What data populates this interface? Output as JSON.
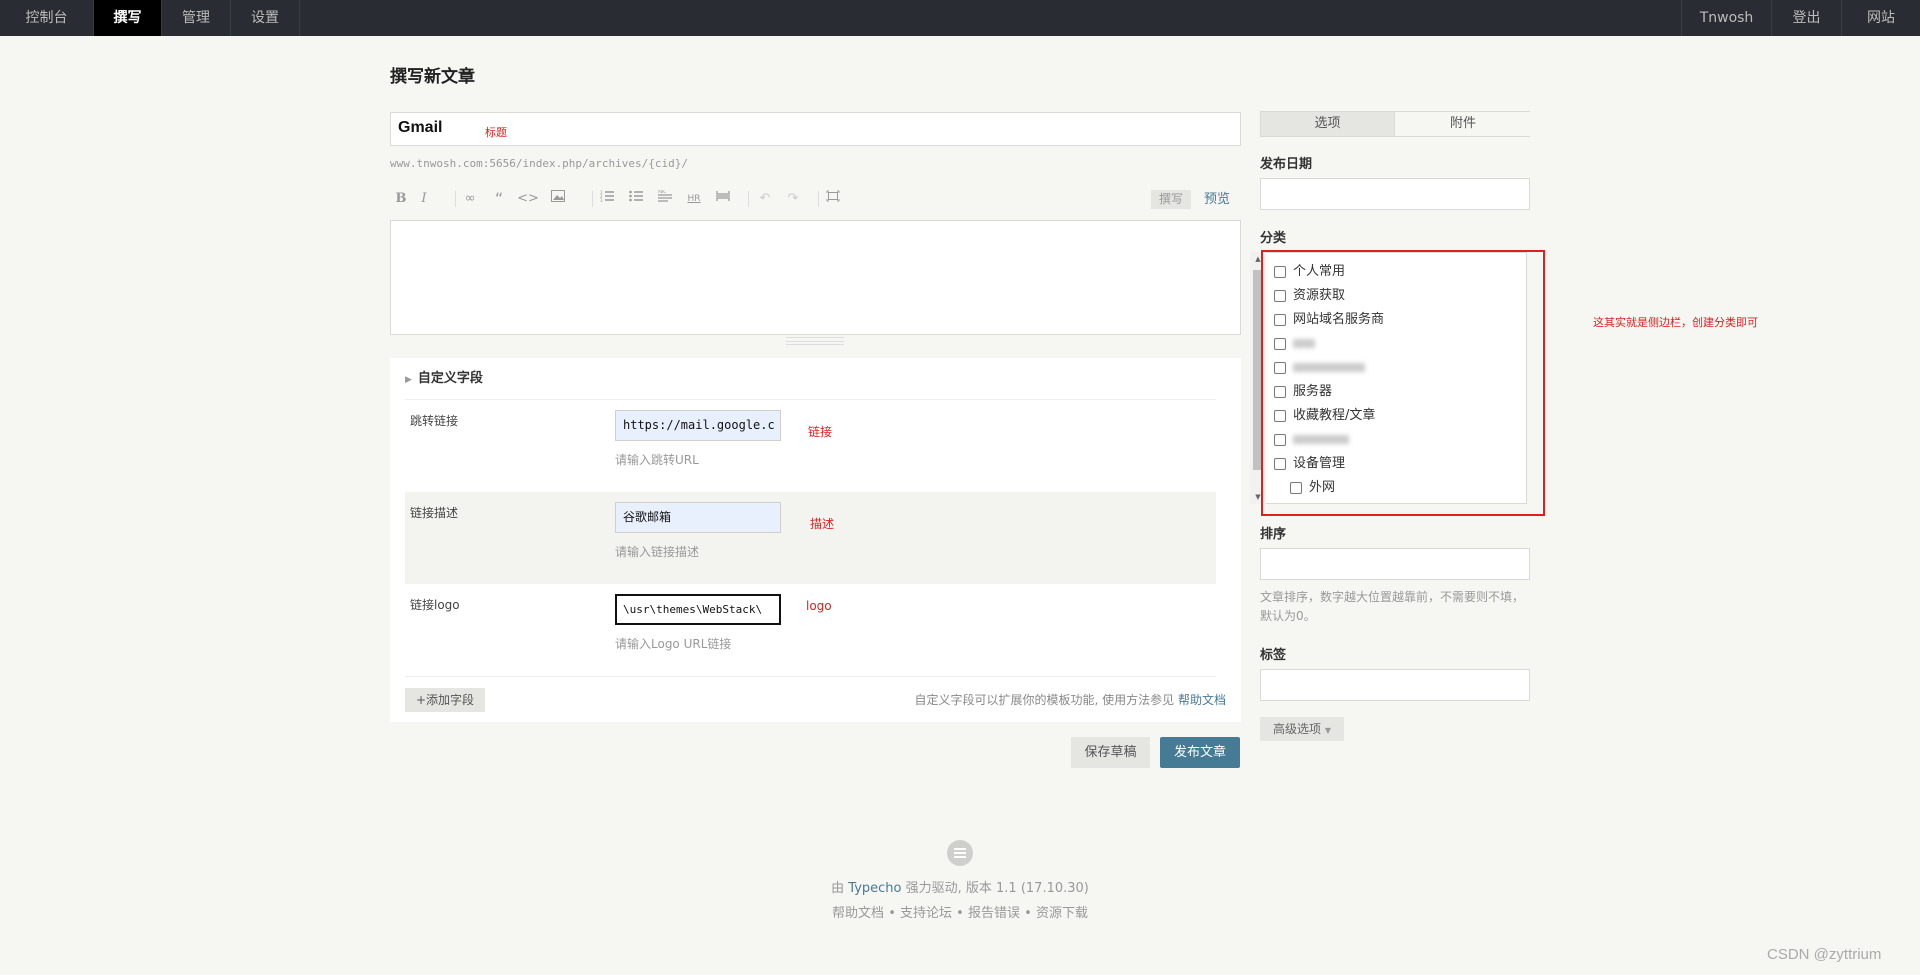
{
  "nav": {
    "left": [
      "控制台",
      "撰写",
      "管理",
      "设置"
    ],
    "right": [
      "Tnwosh",
      "登出",
      "网站"
    ]
  },
  "page_title": "撰写新文章",
  "title_field": {
    "value": "Gmail",
    "annotation": "标题"
  },
  "permalink": "www.tnwosh.com:5656/index.php/archives/{cid}/",
  "editor": {
    "tab_write": "撰写",
    "tab_preview": "预览",
    "icons": [
      "bold-icon",
      "italic-icon",
      "link-icon",
      "quote-icon",
      "code-icon",
      "image-icon",
      "ordered-list-icon",
      "unordered-list-icon",
      "heading-icon",
      "hr-icon",
      "more-icon",
      "undo-icon",
      "redo-icon",
      "fullscreen-icon"
    ]
  },
  "custom_fields": {
    "header": "自定义字段",
    "rows": [
      {
        "label": "跳转链接",
        "value": "https://mail.google.c",
        "hint": "请输入跳转URL",
        "annotation": "链接"
      },
      {
        "label": "链接描述",
        "value": "谷歌邮箱",
        "hint": "请输入链接描述",
        "annotation": "描述"
      },
      {
        "label": "链接logo",
        "value": "\\usr\\themes\\WebStack\\",
        "hint": "请输入Logo URL链接",
        "annotation": "logo"
      }
    ],
    "add_button": "+添加字段",
    "note": "自定义字段可以扩展你的模板功能, 使用方法参见",
    "note_link": "帮助文档"
  },
  "actions": {
    "save_draft": "保存草稿",
    "publish": "发布文章"
  },
  "sidebar": {
    "tabs": [
      "选项",
      "附件"
    ],
    "publish_date_label": "发布日期",
    "category_label": "分类",
    "categories": [
      {
        "name": "个人常用",
        "level": 0,
        "blurred": false
      },
      {
        "name": "资源获取",
        "level": 0,
        "blurred": false
      },
      {
        "name": "网站域名服务商",
        "level": 0,
        "blurred": false
      },
      {
        "name": "",
        "level": 0,
        "blurred": true
      },
      {
        "name": "",
        "level": 0,
        "blurred": true
      },
      {
        "name": "服务器",
        "level": 0,
        "blurred": false
      },
      {
        "name": "收藏教程/文章",
        "level": 0,
        "blurred": false
      },
      {
        "name": "",
        "level": 0,
        "blurred": true
      },
      {
        "name": "设备管理",
        "level": 0,
        "blurred": false
      },
      {
        "name": "外网",
        "level": 1,
        "blurred": false
      }
    ],
    "category_annotation": "这其实就是侧边栏，创建分类即可",
    "order_label": "排序",
    "order_hint": "文章排序，数字越大位置越靠前，不需要则不填，默认为0。",
    "tags_label": "标签",
    "advanced_button": "高级选项"
  },
  "footer": {
    "prefix": "由",
    "brand": "Typecho",
    "suffix": "强力驱动, 版本 1.1 (17.10.30)",
    "links": [
      "帮助文档",
      "支持论坛",
      "报告错误",
      "资源下载"
    ],
    "separator": "•"
  },
  "watermark": "CSDN @zyttrium",
  "colors": {
    "accent": "#467b96",
    "nav_bg": "#292d33",
    "annotation": "#e02020"
  }
}
